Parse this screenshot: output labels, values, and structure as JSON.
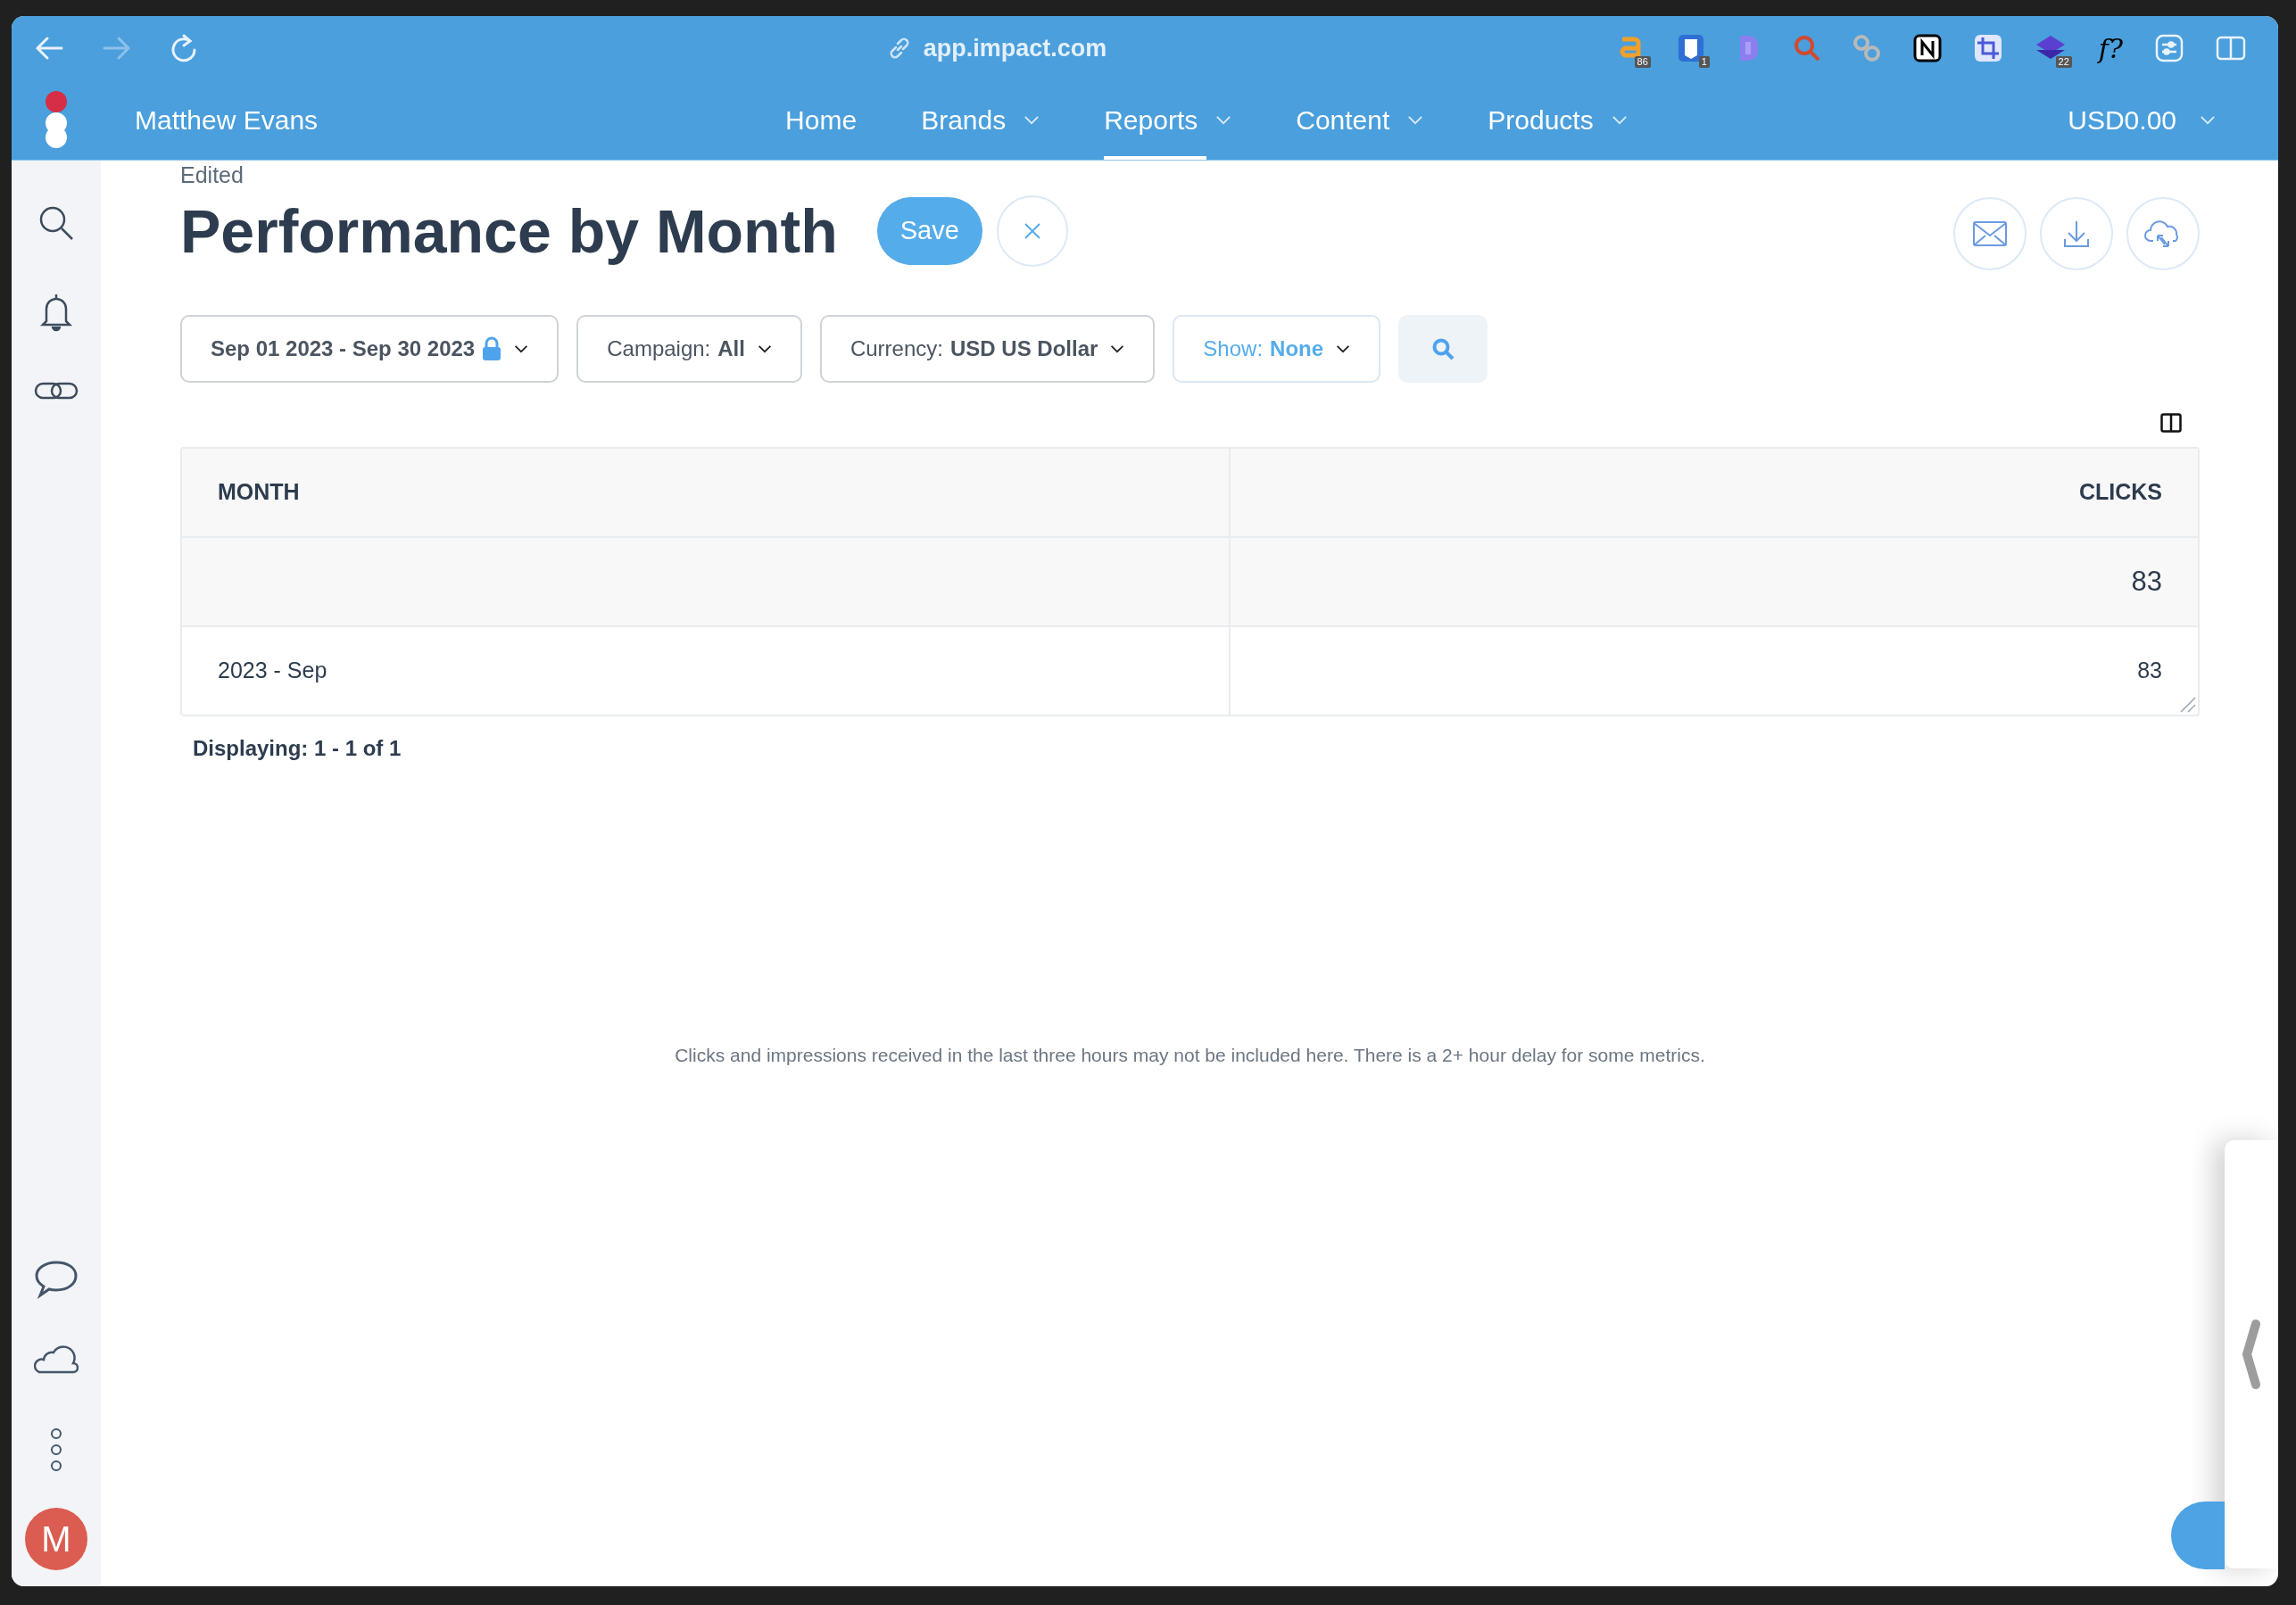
{
  "browser": {
    "url": "app.impact.com",
    "extensions": [
      {
        "kind": "letter-a",
        "badge": "86"
      },
      {
        "kind": "shield",
        "badge": "1"
      },
      {
        "kind": "letter-d"
      },
      {
        "kind": "magnifier"
      },
      {
        "kind": "chain"
      },
      {
        "kind": "notion"
      },
      {
        "kind": "crop"
      },
      {
        "kind": "stack",
        "badge": "22"
      },
      {
        "kind": "text",
        "text": "f?"
      },
      {
        "kind": "sliders"
      },
      {
        "kind": "split"
      }
    ]
  },
  "nav": {
    "account": "Matthew Evans",
    "items": [
      {
        "label": "Home",
        "dropdown": false,
        "selected": false
      },
      {
        "label": "Brands",
        "dropdown": true,
        "selected": false
      },
      {
        "label": "Reports",
        "dropdown": true,
        "selected": true
      },
      {
        "label": "Content",
        "dropdown": true,
        "selected": false
      },
      {
        "label": "Products",
        "dropdown": true,
        "selected": false
      }
    ],
    "balance": "USD0.00"
  },
  "sidebar": {
    "avatar": "M"
  },
  "page": {
    "status": "Edited",
    "title": "Performance by Month",
    "save": "Save"
  },
  "filters": [
    {
      "value": "Sep 01 2023 - Sep 30 2023",
      "locked": true,
      "highlighted": false
    },
    {
      "label": "Campaign:",
      "value": "All",
      "locked": false,
      "highlighted": false
    },
    {
      "label": "Currency:",
      "value": "USD US Dollar",
      "locked": false,
      "highlighted": false
    },
    {
      "label": "Show:",
      "value": "None",
      "locked": false,
      "highlighted": true
    }
  ],
  "table": {
    "columns": [
      "MONTH",
      "CLICKS"
    ],
    "total": {
      "clicks": "83"
    },
    "rows": [
      {
        "month": "2023 - Sep",
        "clicks": "83"
      }
    ]
  },
  "displaying": "Displaying: 1 - 1 of 1",
  "notice": "Clicks and impressions received in the last three hours may not be included here. There is a 2+ hour delay for some metrics."
}
